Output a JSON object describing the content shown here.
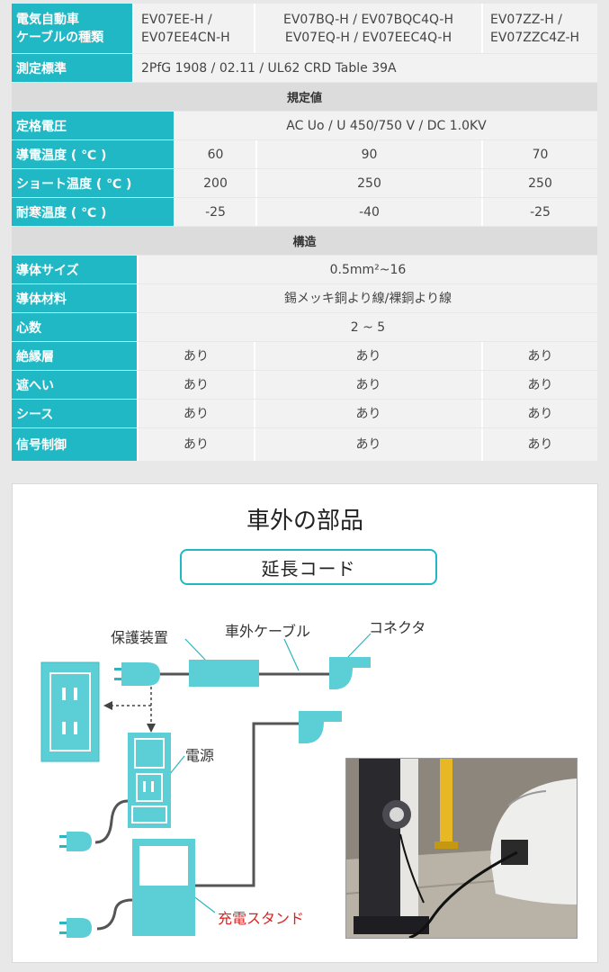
{
  "table": {
    "header": {
      "label": "電気自動車\nケーブルの種類",
      "col1": "EV07EE-H /\nEV07EE4CN-H",
      "col2": "EV07BQ-H / EV07BQC4Q-H\nEV07EQ-H / EV07EEC4Q-H",
      "col3": "EV07ZZ-H /\nEV07ZZC4Z-H"
    },
    "standard": {
      "label": "測定標準",
      "value": "2PfG 1908 / 02.11 / UL62 CRD Table 39A"
    },
    "section_rated": "規定値",
    "rated_voltage": {
      "label": "定格電圧",
      "value": "AC Uo / U 450/750 V / DC 1.0KV"
    },
    "conductor_temp": {
      "label": "導電温度 ( ℃ )",
      "values": [
        "60",
        "90",
        "70"
      ]
    },
    "short_temp": {
      "label": "ショート温度 ( ℃ )",
      "values": [
        "200",
        "250",
        "250"
      ]
    },
    "cold_temp": {
      "label": "耐寒温度 ( ℃ )",
      "values": [
        "-25",
        "-40",
        "-25"
      ]
    },
    "section_structure": "構造",
    "conductor_size": {
      "label": "導体サイズ",
      "value": "0.5mm²~16"
    },
    "conductor_material": {
      "label": "導体材料",
      "value": "錫メッキ銅より線/裸銅より線"
    },
    "cores": {
      "label": "心数",
      "value": "2 ~ 5"
    },
    "insulation": {
      "label": "絶縁層",
      "values": [
        "あり",
        "あり",
        "あり"
      ]
    },
    "shield": {
      "label": "遮へい",
      "values": [
        "あり",
        "あり",
        "あり"
      ]
    },
    "sheath": {
      "label": "シース",
      "values": [
        "あり",
        "あり",
        "あり"
      ]
    },
    "signal": {
      "label": "信号制御",
      "values": [
        "あり",
        "あり",
        "あり"
      ]
    }
  },
  "diagram": {
    "title": "車外の部品",
    "subtitle": "延長コード",
    "labels": {
      "protector": "保護装置",
      "cable": "車外ケーブル",
      "connector": "コネクタ",
      "power": "電源",
      "stand": "充電スタンド"
    }
  },
  "colors": {
    "accent": "#20b8c4",
    "stand_label": "#e02020"
  }
}
